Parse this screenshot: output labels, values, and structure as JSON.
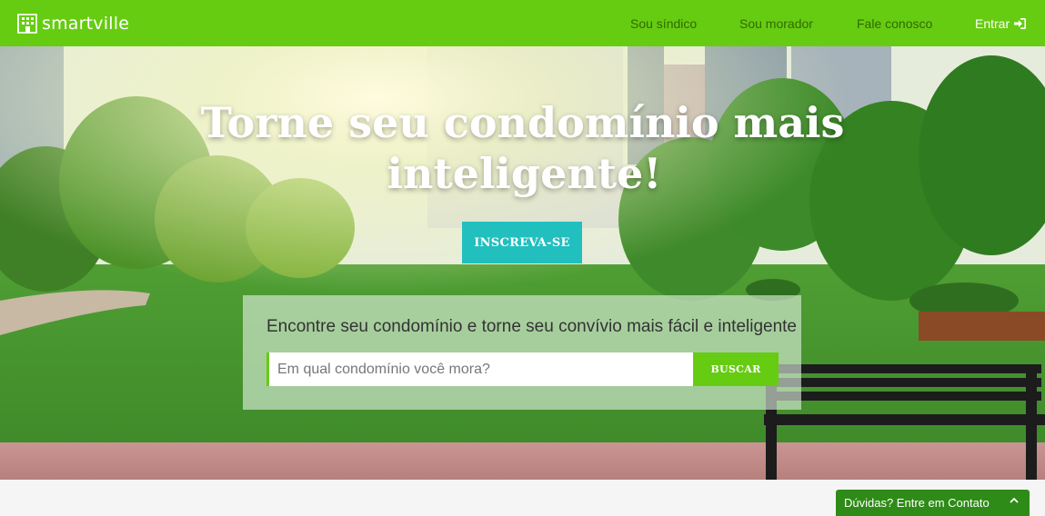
{
  "header": {
    "logo_text": "smartville",
    "nav": [
      {
        "label": "Sou síndico"
      },
      {
        "label": "Sou morador"
      },
      {
        "label": "Fale conosco"
      }
    ],
    "login_label": "Entrar",
    "login_icon": "sign-in-icon"
  },
  "hero": {
    "title_line1": "Torne seu condomínio mais",
    "title_line2": "inteligente!",
    "signup_label": "INSCREVA-SE"
  },
  "search": {
    "heading": "Encontre seu condomínio e torne seu convívio mais fácil e inteligente",
    "placeholder": "Em qual condomínio você mora?",
    "button_label": "BUSCAR"
  },
  "contact_widget": {
    "label": "Dúvidas? Entre em Contato",
    "icon": "chevron-up-icon"
  },
  "colors": {
    "brand_green": "#66cc11",
    "teal": "#22bfbf",
    "widget_green": "#2e8b17"
  }
}
